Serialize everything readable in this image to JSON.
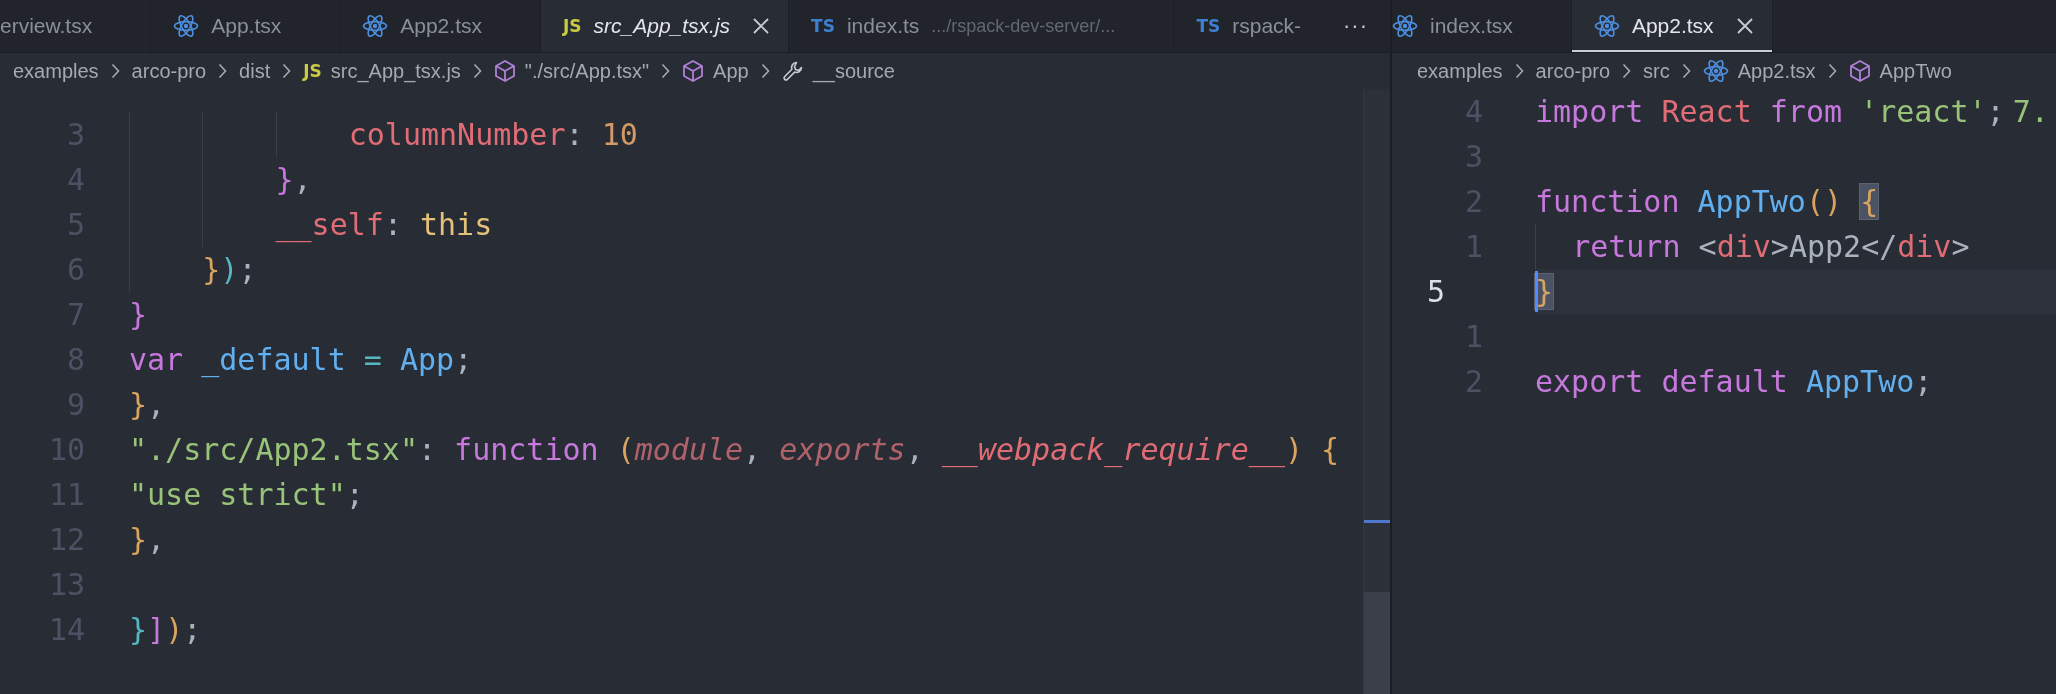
{
  "groups": [
    {
      "focused": false,
      "more": "···",
      "scrollbar": true,
      "tabs": [
        {
          "label": "erview.tsx",
          "selected": false,
          "preview": false
        },
        {
          "label": "App.tsx",
          "icon": {
            "kind": "react"
          },
          "selected": false,
          "preview": false
        },
        {
          "label": "App2.tsx",
          "icon": {
            "kind": "react"
          },
          "selected": false,
          "preview": false
        },
        {
          "label": "src_App_tsx.js",
          "icon": {
            "kind": "badge",
            "text": "JS",
            "color": "#cbcb41"
          },
          "selected": true,
          "preview": true
        },
        {
          "label": "index.ts",
          "description": ".../rspack-dev-server/...",
          "icon": {
            "kind": "badge",
            "text": "TS",
            "color": "#3d7fd0"
          },
          "selected": false,
          "preview": false
        },
        {
          "label": "rspack-",
          "icon": {
            "kind": "badge",
            "text": "TS",
            "color": "#3d7fd0"
          },
          "selected": false,
          "preview": false
        }
      ],
      "breadcrumbs": [
        {
          "label": "examples"
        },
        {
          "label": "arco-pro"
        },
        {
          "label": "dist"
        },
        {
          "label": "src_App_tsx.js",
          "icon": {
            "kind": "badge",
            "text": "JS",
            "color": "#cbcb41"
          }
        },
        {
          "label": "\"./src/App.tsx\"",
          "icon": {
            "kind": "cube"
          }
        },
        {
          "label": "App",
          "icon": {
            "kind": "cube"
          }
        },
        {
          "label": "__source",
          "icon": {
            "kind": "wrench"
          }
        }
      ],
      "lines": [
        {
          "number": "3",
          "current": false,
          "tokens": [
            {
              "text": "            columnNumber",
              "kind": "property"
            },
            {
              "text": ": ",
              "kind": "punct"
            },
            {
              "text": "10",
              "kind": "number"
            }
          ]
        },
        {
          "number": "4",
          "current": false,
          "tokens": [
            {
              "text": "        }",
              "kind": "bracket2"
            },
            {
              "text": ",",
              "kind": "punct"
            }
          ]
        },
        {
          "number": "5",
          "current": false,
          "tokens": [
            {
              "text": "        __self",
              "kind": "property"
            },
            {
              "text": ": ",
              "kind": "punct"
            },
            {
              "text": "this",
              "kind": "this"
            }
          ]
        },
        {
          "number": "6",
          "current": false,
          "tokens": [
            {
              "text": "    }",
              "kind": "bracket1"
            },
            {
              "text": ")",
              "kind": "bracket3"
            },
            {
              "text": ";",
              "kind": "punct"
            }
          ]
        },
        {
          "number": "7",
          "current": false,
          "tokens": [
            {
              "text": "}",
              "kind": "bracket2"
            }
          ]
        },
        {
          "number": "8",
          "current": false,
          "tokens": [
            {
              "text": "var",
              "kind": "keyword"
            },
            {
              "text": " _default",
              "kind": "func"
            },
            {
              "text": " = ",
              "kind": "operator"
            },
            {
              "text": "App",
              "kind": "func"
            },
            {
              "text": ";",
              "kind": "punct"
            }
          ]
        },
        {
          "number": "9",
          "current": false,
          "tokens": [
            {
              "text": "}",
              "kind": "bracket1"
            },
            {
              "text": ",",
              "kind": "punct"
            }
          ]
        },
        {
          "number": "10",
          "current": false,
          "tokens": [
            {
              "text": "\"./src/App2.tsx\"",
              "kind": "string"
            },
            {
              "text": ": ",
              "kind": "punct"
            },
            {
              "text": "function",
              "kind": "keyword"
            },
            {
              "text": " (",
              "kind": "bracket1"
            },
            {
              "text": "module",
              "kind": "param"
            },
            {
              "text": ", ",
              "kind": "punct"
            },
            {
              "text": "exports",
              "kind": "param"
            },
            {
              "text": ", ",
              "kind": "punct"
            },
            {
              "text": "__webpack_require__",
              "kind": "param2"
            },
            {
              "text": ") {",
              "kind": "bracket1"
            }
          ]
        },
        {
          "number": "11",
          "current": false,
          "tokens": [
            {
              "text": "\"use strict\"",
              "kind": "string"
            },
            {
              "text": ";",
              "kind": "punct"
            }
          ]
        },
        {
          "number": "12",
          "current": false,
          "tokens": [
            {
              "text": "}",
              "kind": "bracket1"
            },
            {
              "text": ",",
              "kind": "punct"
            }
          ]
        },
        {
          "number": "13",
          "current": false
        },
        {
          "number": "14",
          "current": false,
          "tokens": [
            {
              "text": "}",
              "kind": "bracket3"
            },
            {
              "text": "]",
              "kind": "bracket2"
            },
            {
              "text": ")",
              "kind": "bracket1"
            },
            {
              "text": ";",
              "kind": "punct"
            }
          ]
        }
      ]
    },
    {
      "focused": true,
      "tabs": [
        {
          "label": "index.tsx",
          "icon": {
            "kind": "react"
          },
          "selected": false,
          "preview": false
        },
        {
          "label": "App2.tsx",
          "icon": {
            "kind": "react"
          },
          "selected": true,
          "preview": false
        }
      ],
      "breadcrumbs": [
        {
          "label": "examples"
        },
        {
          "label": "arco-pro"
        },
        {
          "label": "src"
        },
        {
          "label": "App2.tsx",
          "icon": {
            "kind": "react"
          }
        },
        {
          "label": "AppTwo",
          "icon": {
            "kind": "cube"
          }
        }
      ],
      "lines": [
        {
          "number": "4",
          "current": false,
          "tokens": [
            {
              "text": "import",
              "kind": "keyword"
            },
            {
              "text": " React",
              "kind": "variable"
            },
            {
              "text": " from",
              "kind": "keyword"
            },
            {
              "text": " 'react'",
              "kind": "string"
            },
            {
              "text": ";",
              "kind": "punct"
            },
            {
              "text": "7.",
              "kind": "inlay"
            }
          ]
        },
        {
          "number": "3",
          "current": false
        },
        {
          "number": "2",
          "current": false,
          "tokens": [
            {
              "text": "function",
              "kind": "keyword"
            },
            {
              "text": " AppTwo",
              "kind": "func"
            },
            {
              "text": "() ",
              "kind": "bracket1"
            },
            {
              "text": "{",
              "kind": "bracket_match"
            }
          ]
        },
        {
          "number": "1",
          "current": false,
          "tokens": [
            {
              "text": "  return",
              "kind": "keyword"
            },
            {
              "text": " <",
              "kind": "punct"
            },
            {
              "text": "div",
              "kind": "tag"
            },
            {
              "text": ">",
              "kind": "punct"
            },
            {
              "text": "App2",
              "kind": "plain"
            },
            {
              "text": "</",
              "kind": "punct"
            },
            {
              "text": "div",
              "kind": "tag"
            },
            {
              "text": ">",
              "kind": "punct"
            }
          ]
        },
        {
          "number": "5",
          "current": true,
          "tokens": [
            {
              "text": "}",
              "kind": "bracket_match"
            }
          ]
        },
        {
          "number": "1",
          "current": false
        },
        {
          "number": "2",
          "current": false,
          "tokens": [
            {
              "text": "export",
              "kind": "keyword"
            },
            {
              "text": " default",
              "kind": "keyword"
            },
            {
              "text": " AppTwo",
              "kind": "func"
            },
            {
              "text": ";",
              "kind": "punct"
            }
          ]
        }
      ]
    }
  ]
}
